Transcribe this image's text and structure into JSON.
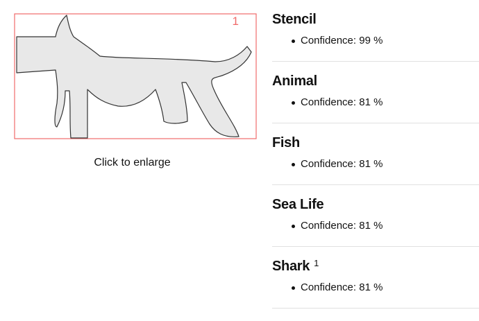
{
  "preview": {
    "box_number": "1",
    "box_color": "#f06a6a",
    "shape_fill": "#e8e8e8",
    "shape_stroke": "#333333",
    "enlarge_text": "Click to enlarge"
  },
  "labels": [
    {
      "name": "Stencil",
      "marker": "",
      "confidence": "Confidence: 99 %"
    },
    {
      "name": "Animal",
      "marker": "",
      "confidence": "Confidence: 81 %"
    },
    {
      "name": "Fish",
      "marker": "",
      "confidence": "Confidence: 81 %"
    },
    {
      "name": "Sea Life",
      "marker": "",
      "confidence": "Confidence: 81 %"
    },
    {
      "name": "Shark",
      "marker": "1",
      "confidence": "Confidence: 81 %"
    }
  ]
}
